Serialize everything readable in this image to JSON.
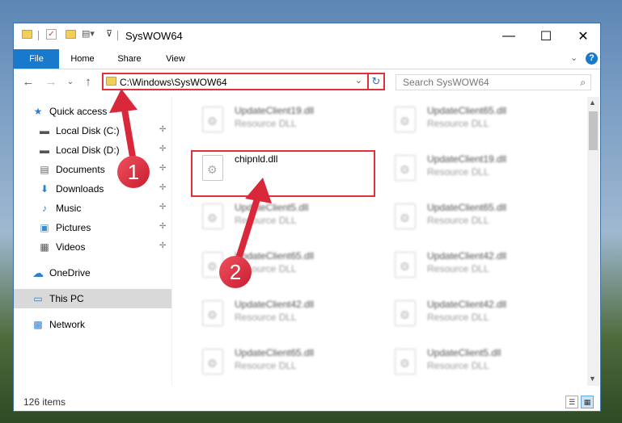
{
  "window": {
    "title": "SysWOW64",
    "controls": {
      "minimize": "—",
      "maximize": "☐",
      "close": "✕"
    }
  },
  "ribbon": {
    "tabs": [
      {
        "label": "File"
      },
      {
        "label": "Home"
      },
      {
        "label": "Share"
      },
      {
        "label": "View"
      }
    ],
    "expand_icon": "⌄",
    "help_icon": "?"
  },
  "address_bar": {
    "path": "C:\\Windows\\SysWOW64",
    "refresh_icon": "↻",
    "dropdown_icon": "⌄"
  },
  "navigation_buttons": {
    "back": "←",
    "forward": "→",
    "recent": "⌄",
    "up": "↑"
  },
  "search": {
    "placeholder": "Search SysWOW64",
    "icon": "⌕"
  },
  "sidebar": {
    "items": [
      {
        "label": "Quick access",
        "icon": "★"
      },
      {
        "label": "Local Disk (C:)",
        "icon": "▬"
      },
      {
        "label": "Local Disk (D:)",
        "icon": "▬"
      },
      {
        "label": "Documents",
        "icon": "▤"
      },
      {
        "label": "Downloads",
        "icon": "⬇"
      },
      {
        "label": "Music",
        "icon": "♪"
      },
      {
        "label": "Pictures",
        "icon": "▣"
      },
      {
        "label": "Videos",
        "icon": "▦"
      },
      {
        "label": "OneDrive",
        "icon": "☁"
      },
      {
        "label": "This PC",
        "icon": "▭"
      },
      {
        "label": "Network",
        "icon": "▩"
      }
    ],
    "pin_icon": "📌"
  },
  "files": [
    {
      "name": "UpdateClient19.dll",
      "type": "Resource DLL"
    },
    {
      "name": "UpdateClient65.dll",
      "type": "Resource DLL"
    },
    {
      "name": "chipnld.dll",
      "type": ""
    },
    {
      "name": "UpdateClient19.dll",
      "type": "Resource DLL"
    },
    {
      "name": "UpdateClient5.dll",
      "type": "Resource DLL"
    },
    {
      "name": "UpdateClient65.dll",
      "type": "Resource DLL"
    },
    {
      "name": "UpdateClient65.dll",
      "type": "Resource DLL"
    },
    {
      "name": "UpdateClient42.dll",
      "type": "Resource DLL"
    },
    {
      "name": "UpdateClient42.dll",
      "type": "Resource DLL"
    },
    {
      "name": "UpdateClient42.dll",
      "type": "Resource DLL"
    },
    {
      "name": "UpdateClient65.dll",
      "type": "Resource DLL"
    },
    {
      "name": "UpdateClient5.dll",
      "type": "Resource DLL"
    }
  ],
  "status_bar": {
    "item_count": "126 items"
  },
  "annotations": {
    "step1": "1",
    "step2": "2"
  },
  "colors": {
    "accent": "#1979ca",
    "highlight": "#e0303a"
  }
}
